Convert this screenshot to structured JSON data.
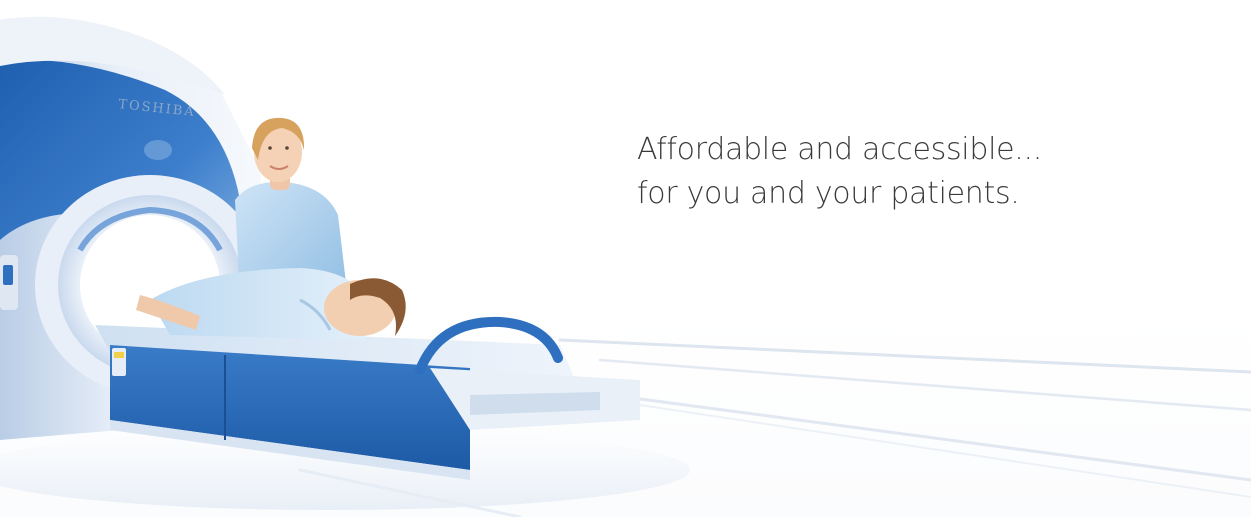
{
  "tagline": {
    "line1": "Affordable and accessible...",
    "line2": "for you and your patients."
  },
  "scanner": {
    "brand": "TOSHIBA"
  },
  "colors": {
    "scanner_blue": "#2f6fc0",
    "scanner_light": "#dce8f6",
    "gown_blue": "#a9cdea",
    "text": "#3a3a3a"
  }
}
